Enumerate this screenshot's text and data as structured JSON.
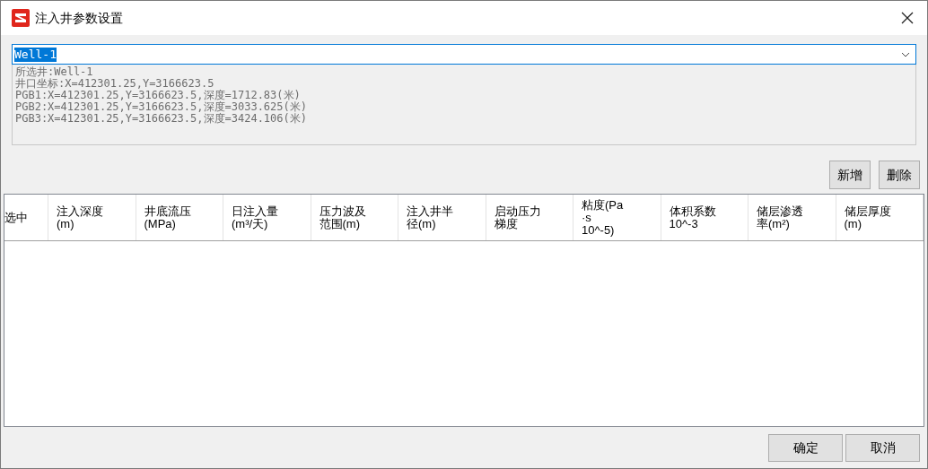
{
  "window": {
    "title": "注入井参数设置"
  },
  "well_select": {
    "value": "Well-1"
  },
  "info_lines": [
    "所选井:Well-1",
    "井口坐标:X=412301.25,Y=3166623.5",
    "PGB1:X=412301.25,Y=3166623.5,深度=1712.83(米)",
    "PGB2:X=412301.25,Y=3166623.5,深度=3033.625(米)",
    "PGB3:X=412301.25,Y=3166623.5,深度=3424.106(米)"
  ],
  "toolbar_buttons": [
    "新增",
    "删除"
  ],
  "table": {
    "columns": [
      {
        "lines": [
          "选中"
        ]
      },
      {
        "lines": [
          "注入深度",
          "(m)"
        ]
      },
      {
        "lines": [
          "井底流压",
          "(MPa)"
        ]
      },
      {
        "lines": [
          "日注入量",
          "(m³/天)"
        ]
      },
      {
        "lines": [
          "压力波及",
          "范围(m)"
        ]
      },
      {
        "lines": [
          "注入井半",
          "径(m)"
        ]
      },
      {
        "lines": [
          "启动压力",
          "梯度"
        ]
      },
      {
        "lines": [
          "粘度(Pa",
          "·s",
          "10^-5)"
        ]
      },
      {
        "lines": [
          "体积系数",
          "10^-3"
        ]
      },
      {
        "lines": [
          "储层渗透",
          "率(m²)"
        ]
      },
      {
        "lines": [
          "储层厚度",
          "(m)"
        ]
      }
    ]
  },
  "footer_buttons": [
    "确定",
    "取消"
  ]
}
